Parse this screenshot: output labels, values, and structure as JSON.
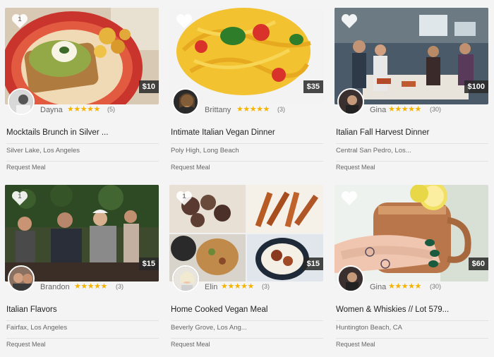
{
  "listings": [
    {
      "price": "$10",
      "host": "Dayna",
      "stars": "★★★★★",
      "reviews": "(5)",
      "title": "Mocktails Brunch in Silver ...",
      "location": "Silver Lake, Los Angeles",
      "cta": "Request Meal",
      "likes": "1"
    },
    {
      "price": "$35",
      "host": "Brittany",
      "stars": "★★★★★",
      "reviews": "(3)",
      "title": "Intimate Italian Vegan Dinner",
      "location": "Poly High, Long Beach",
      "cta": "Request Meal",
      "likes": ""
    },
    {
      "price": "$100",
      "host": "Gina",
      "stars": "★★★★★",
      "reviews": "(30)",
      "title": "Italian Fall Harvest Dinner",
      "location": "Central San Pedro, Los...",
      "cta": "Request Meal",
      "likes": ""
    },
    {
      "price": "$15",
      "host": "Brandon",
      "stars": "★★★★★",
      "reviews": "(3)",
      "title": "Italian Flavors",
      "location": "Fairfax, Los Angeles",
      "cta": "Request Meal",
      "likes": "1"
    },
    {
      "price": "$15",
      "host": "Elin",
      "stars": "★★★★★",
      "reviews": "(3)",
      "title": "Home Cooked Vegan Meal",
      "location": "Beverly Grove, Los Ang...",
      "cta": "Request Meal",
      "likes": "1"
    },
    {
      "price": "$60",
      "host": "Gina",
      "stars": "★★★★★",
      "reviews": "(30)",
      "title": "Women & Whiskies // Lot 579...",
      "location": "Huntington Beach, CA",
      "cta": "Request Meal",
      "likes": ""
    }
  ],
  "colors": {
    "star": "#f5b400",
    "price_bg": "#2b2b2b",
    "page_bg": "#f4f4f4"
  }
}
